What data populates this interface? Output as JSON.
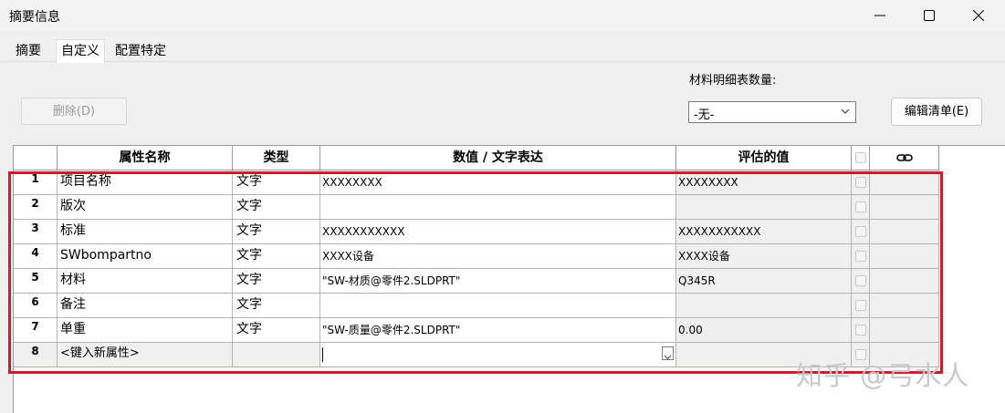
{
  "window": {
    "title": "摘要信息"
  },
  "tabs": [
    {
      "label": "摘要",
      "selected": false
    },
    {
      "label": "自定义",
      "selected": true
    },
    {
      "label": "配置特定",
      "selected": false
    }
  ],
  "toolbar": {
    "delete_label": "删除(D)",
    "bom_label": "材料明细表数量:",
    "bom_value": "-无-",
    "edit_list_label": "编辑清单(E)"
  },
  "table": {
    "headers": [
      "属性名称",
      "类型",
      "数值 / 文字表达",
      "评估的值"
    ],
    "rows": [
      {
        "num": "1",
        "name": "项目名称",
        "type": "文字",
        "value": "XXXXXXXX",
        "evaluated": "XXXXXXXX"
      },
      {
        "num": "2",
        "name": "版次",
        "type": "文字",
        "value": "",
        "evaluated": ""
      },
      {
        "num": "3",
        "name": "标准",
        "type": "文字",
        "value": "XXXXXXXXXXX",
        "evaluated": "XXXXXXXXXXX"
      },
      {
        "num": "4",
        "name": "SWbompartno",
        "type": "文字",
        "value": "XXXX设备",
        "evaluated": "XXXX设备"
      },
      {
        "num": "5",
        "name": "材料",
        "type": "文字",
        "value": "\"SW-材质@零件2.SLDPRT\"",
        "evaluated": "Q345R"
      },
      {
        "num": "6",
        "name": "备注",
        "type": "文字",
        "value": "",
        "evaluated": ""
      },
      {
        "num": "7",
        "name": "单重",
        "type": "文字",
        "value": "\"SW-质量@零件2.SLDPRT\"",
        "evaluated": "0.00"
      }
    ],
    "new_row": {
      "num": "8",
      "name": "<键入新属性>"
    }
  },
  "watermark": "知乎 @弓水人",
  "colors": {
    "highlight": "#d11a2a",
    "grid_line": "#9a9a9a",
    "readonly_bg": "#f0f0f0"
  }
}
